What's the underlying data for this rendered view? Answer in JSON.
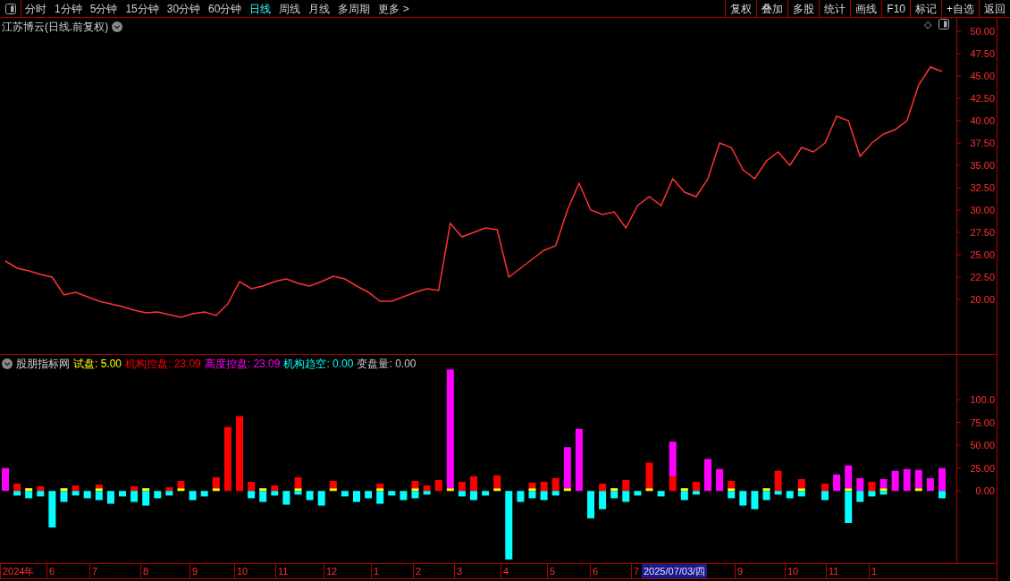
{
  "toolbar": {
    "periods": [
      {
        "label": "分时",
        "selected": false
      },
      {
        "label": "1分钟",
        "selected": false
      },
      {
        "label": "5分钟",
        "selected": false
      },
      {
        "label": "15分钟",
        "selected": false
      },
      {
        "label": "30分钟",
        "selected": false
      },
      {
        "label": "60分钟",
        "selected": false
      },
      {
        "label": "日线",
        "selected": true
      },
      {
        "label": "周线",
        "selected": false
      },
      {
        "label": "月线",
        "selected": false
      },
      {
        "label": "多周期",
        "selected": false
      },
      {
        "label": "更多 >",
        "selected": false
      }
    ],
    "actions": [
      "复权",
      "叠加",
      "多股",
      "统计",
      "画线",
      "F10",
      "标记",
      "+自选",
      "返回"
    ]
  },
  "main_chart": {
    "title": "江苏博云(日线.前复权)",
    "marker": "◇",
    "chart_data": {
      "type": "line",
      "ylim": [
        13.8,
        51.5
      ],
      "yticks": [
        {
          "value": 20,
          "label": "20.00"
        },
        {
          "value": 22.5,
          "label": "22.50"
        },
        {
          "value": 25,
          "label": "25.00"
        },
        {
          "value": 27.5,
          "label": "27.50"
        },
        {
          "value": 30,
          "label": "30.00"
        },
        {
          "value": 32.5,
          "label": "32.50"
        },
        {
          "value": 35,
          "label": "35.00"
        },
        {
          "value": 37.5,
          "label": "37.50"
        },
        {
          "value": 40,
          "label": "40.00"
        },
        {
          "value": 42.5,
          "label": "42.50"
        },
        {
          "value": 45,
          "label": "45.00"
        },
        {
          "value": 47.5,
          "label": "47.50"
        },
        {
          "value": 50,
          "label": "50.00"
        }
      ],
      "categories": [
        null,
        null,
        null,
        null,
        null,
        null,
        null,
        null,
        null,
        null,
        null,
        null,
        null,
        null,
        null,
        null,
        null,
        null,
        null,
        null,
        null,
        null,
        null,
        null,
        null,
        null,
        null,
        null,
        null,
        null,
        null,
        null,
        null,
        null,
        null,
        null,
        null,
        null,
        null,
        null,
        null,
        null,
        null,
        null,
        null,
        null,
        null,
        null,
        null,
        null,
        null,
        null,
        null,
        null,
        null,
        null,
        null,
        null,
        null,
        null,
        null,
        null,
        null,
        null,
        null,
        null,
        null,
        null,
        null,
        null,
        null,
        null,
        null,
        null,
        null,
        null,
        null,
        null,
        null,
        null,
        null
      ],
      "series": [
        {
          "color": "#ff3232",
          "values": [
            24.3,
            23.5,
            23.2,
            22.8,
            22.5,
            20.5,
            20.8,
            20.3,
            19.8,
            19.5,
            19.2,
            18.8,
            18.5,
            18.6,
            18.3,
            18.0,
            18.4,
            18.6,
            18.2,
            19.5,
            22.0,
            21.2,
            21.5,
            22.0,
            22.3,
            21.8,
            21.5,
            22.0,
            22.6,
            22.3,
            21.5,
            20.8,
            19.8,
            19.8,
            20.3,
            20.8,
            21.2,
            21.0,
            28.5,
            27.0,
            27.5,
            28.0,
            27.8,
            22.5,
            23.5,
            24.5,
            25.5,
            26.0,
            30.0,
            33.0,
            30.0,
            29.5,
            29.8,
            28.0,
            30.5,
            31.5,
            30.5,
            33.5,
            32.0,
            31.5,
            33.5,
            37.5,
            37.0,
            34.5,
            33.5,
            35.5,
            36.5,
            35.0,
            37.0,
            36.5,
            37.5,
            40.5,
            40.0,
            36.0,
            37.5,
            38.5,
            39.0,
            40.0,
            44.0,
            46.0,
            45.5
          ]
        }
      ]
    }
  },
  "indicator": {
    "title": "股朋指标网",
    "readings": [
      ": 5.00",
      ": 23.09",
      ": 23.09",
      ": 0.00"
    ],
    "extra_legend": {
      "label": "变盘量: 0.00"
    },
    "chart_data": {
      "type": "bar",
      "stacked": true,
      "ylim": [
        -79,
        149
      ],
      "yticks": [
        {
          "value": 0,
          "label": "0.00"
        },
        {
          "value": 25,
          "label": "25.00"
        },
        {
          "value": 50,
          "label": "50.00"
        },
        {
          "value": 75,
          "label": "75.00"
        },
        {
          "value": 100,
          "label": "100.0"
        }
      ],
      "categories": [
        null,
        null,
        null,
        null,
        null,
        null,
        null,
        null,
        null,
        null,
        null,
        null,
        null,
        null,
        null,
        null,
        null,
        null,
        null,
        null,
        null,
        null,
        null,
        null,
        null,
        null,
        null,
        null,
        null,
        null,
        null,
        null,
        null,
        null,
        null,
        null,
        null,
        null,
        null,
        null,
        null,
        null,
        null,
        null,
        null,
        null,
        null,
        null,
        null,
        null,
        null,
        null,
        null,
        null,
        null,
        null,
        null,
        null,
        null,
        null,
        null,
        null,
        null,
        null,
        null,
        null,
        null,
        null,
        null,
        null,
        null,
        null,
        null,
        null,
        null,
        null,
        null,
        null,
        null,
        null,
        null
      ],
      "series": [
        {
          "name": "试盘",
          "color": "#ffff00",
          "values": [
            null,
            null,
            3,
            null,
            null,
            3,
            null,
            null,
            3,
            null,
            null,
            null,
            3,
            null,
            null,
            3,
            null,
            null,
            3,
            null,
            null,
            null,
            3,
            null,
            null,
            3,
            null,
            null,
            3,
            null,
            null,
            null,
            3,
            null,
            null,
            3,
            null,
            null,
            3,
            null,
            null,
            null,
            3,
            null,
            null,
            3,
            null,
            null,
            3,
            null,
            null,
            null,
            3,
            null,
            null,
            3,
            null,
            null,
            3,
            null,
            null,
            null,
            3,
            null,
            null,
            3,
            null,
            null,
            3,
            null,
            null,
            null,
            3,
            null,
            null,
            3,
            null,
            null,
            3,
            null,
            null
          ]
        },
        {
          "name": "机构控盘",
          "color": "#ff0000",
          "values": [
            null,
            8,
            null,
            5,
            null,
            null,
            6,
            null,
            4,
            null,
            null,
            5,
            null,
            null,
            4,
            8,
            null,
            null,
            12,
            70,
            82,
            10,
            null,
            6,
            null,
            12,
            null,
            null,
            8,
            null,
            null,
            null,
            5,
            null,
            null,
            8,
            6,
            12,
            null,
            10,
            16,
            null,
            14,
            null,
            null,
            6,
            10,
            14,
            null,
            null,
            null,
            8,
            null,
            12,
            null,
            28,
            null,
            16,
            null,
            10,
            null,
            null,
            8,
            null,
            null,
            null,
            22,
            null,
            10,
            null,
            8,
            null,
            null,
            null,
            10,
            null,
            null,
            null,
            null,
            null,
            null
          ]
        },
        {
          "name": "高度控盘",
          "color": "#ff00ff",
          "values": [
            25,
            null,
            null,
            null,
            null,
            null,
            null,
            null,
            null,
            null,
            null,
            null,
            null,
            null,
            null,
            null,
            null,
            null,
            null,
            null,
            null,
            null,
            null,
            null,
            null,
            null,
            null,
            null,
            null,
            null,
            null,
            null,
            null,
            null,
            null,
            null,
            null,
            null,
            130,
            null,
            null,
            null,
            null,
            null,
            null,
            null,
            null,
            null,
            45,
            68,
            null,
            null,
            null,
            null,
            null,
            null,
            null,
            38,
            null,
            null,
            35,
            24,
            null,
            null,
            null,
            null,
            null,
            null,
            null,
            null,
            null,
            18,
            25,
            14,
            null,
            10,
            22,
            24,
            20,
            14,
            25
          ]
        },
        {
          "name": "机构趋空",
          "color": "#00ffff",
          "values": [
            null,
            -5,
            -8,
            -6,
            -40,
            -12,
            -5,
            -8,
            -10,
            -14,
            -6,
            -12,
            -16,
            -8,
            -5,
            null,
            -10,
            -6,
            null,
            null,
            null,
            -8,
            -12,
            -5,
            -15,
            -4,
            -10,
            -16,
            null,
            -6,
            -12,
            -8,
            -14,
            -5,
            -10,
            -8,
            -4,
            null,
            null,
            -6,
            -10,
            -5,
            null,
            -75,
            -12,
            -8,
            -10,
            -5,
            null,
            null,
            -30,
            -20,
            -8,
            -12,
            -5,
            null,
            -6,
            null,
            -10,
            -4,
            null,
            null,
            -8,
            -16,
            -20,
            -10,
            -4,
            -8,
            -6,
            null,
            -10,
            null,
            -35,
            -12,
            -6,
            -4,
            null,
            null,
            null,
            null,
            -8
          ]
        }
      ]
    }
  },
  "date_axis": {
    "labels": [
      "2024年",
      "6",
      "7",
      "8",
      "9",
      "10",
      "11",
      "12",
      "1",
      "2",
      "3",
      "4",
      "5",
      "6",
      "7",
      "9",
      "10",
      "11",
      "1"
    ],
    "cursor": "2025/07/03/四"
  }
}
